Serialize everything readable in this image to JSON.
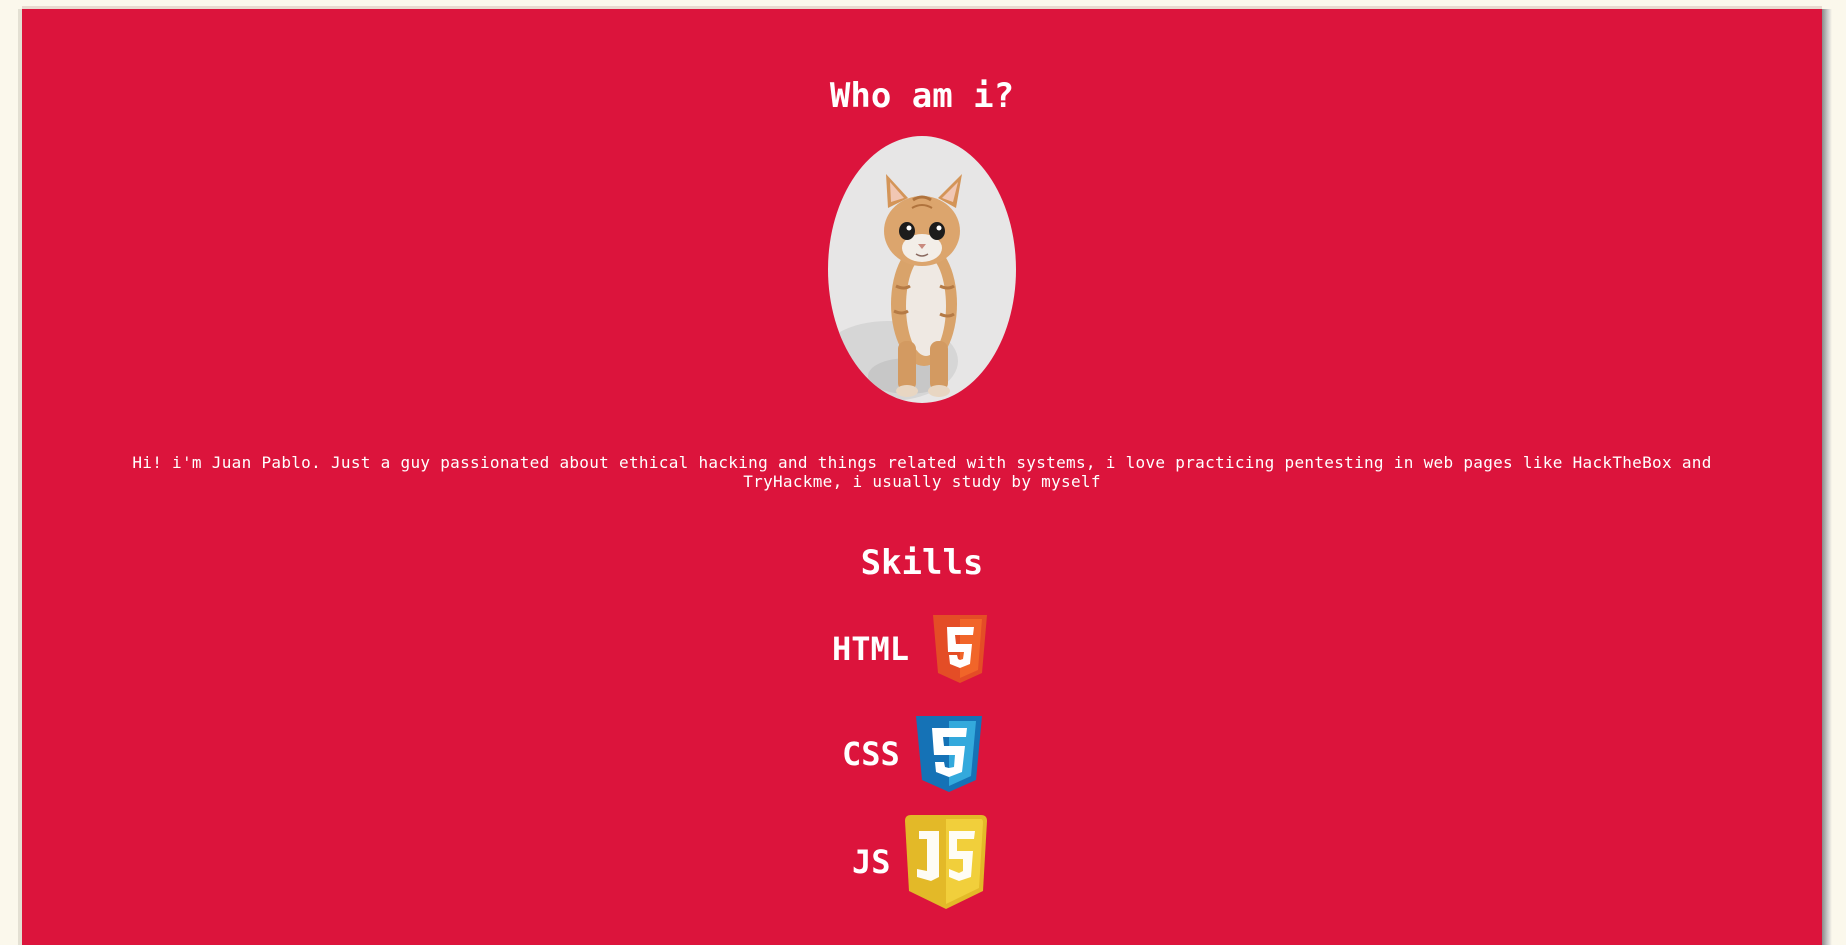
{
  "about": {
    "heading": "Who am i?",
    "avatar_icon": "kitten-photo",
    "bio": "Hi! i'm Juan Pablo. Just a guy passionated about ethical hacking and things related with systems, i love practicing pentesting in web pages like HackTheBox and TryHackme, i usually study by myself"
  },
  "skills": {
    "heading": "Skills",
    "items": [
      {
        "label": "HTML",
        "icon": "html5-logo-icon",
        "color": "#e44d26"
      },
      {
        "label": "CSS",
        "icon": "css3-logo-icon",
        "color": "#1572b6"
      },
      {
        "label": "JS",
        "icon": "js-logo-icon",
        "color": "#e9c73a"
      }
    ]
  },
  "colors": {
    "page_background": "#dc143c",
    "text": "#ffffff"
  }
}
